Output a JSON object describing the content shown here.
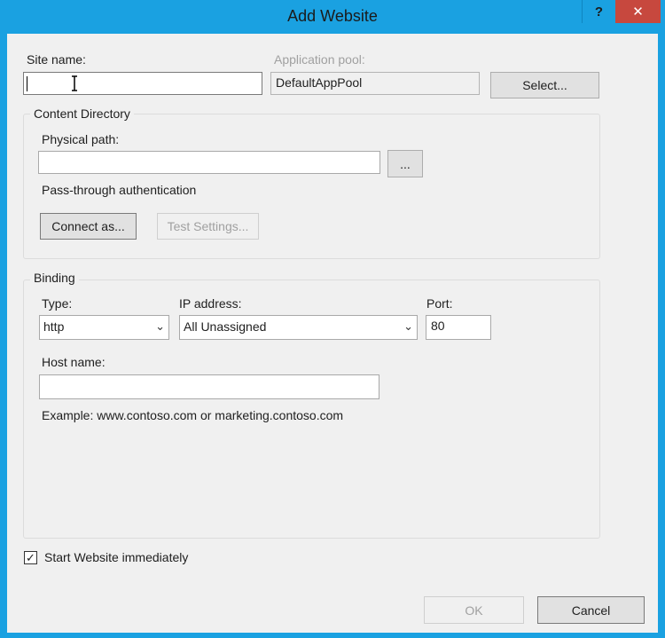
{
  "window": {
    "title": "Add Website",
    "help_label": "?",
    "close_label": "✕"
  },
  "site": {
    "site_name_label": "Site name:",
    "site_name_value": "",
    "app_pool_label": "Application pool:",
    "app_pool_value": "DefaultAppPool",
    "select_button": "Select..."
  },
  "content_directory": {
    "group_label": "Content Directory",
    "physical_path_label": "Physical path:",
    "physical_path_value": "",
    "browse_button": "...",
    "pass_through_label": "Pass-through authentication",
    "connect_as_button": "Connect as...",
    "test_settings_button": "Test Settings..."
  },
  "binding": {
    "group_label": "Binding",
    "type_label": "Type:",
    "type_value": "http",
    "ip_label": "IP address:",
    "ip_value": "All Unassigned",
    "port_label": "Port:",
    "port_value": "80",
    "host_label": "Host name:",
    "host_value": "",
    "example_text": "Example: www.contoso.com or marketing.contoso.com"
  },
  "start": {
    "label": "Start Website immediately",
    "checked": true,
    "check_glyph": "✓"
  },
  "footer": {
    "ok_button": "OK",
    "cancel_button": "Cancel"
  },
  "colors": {
    "titlebar": "#1aa1e1",
    "close": "#c7483e",
    "dialog_bg": "#f0f0f0"
  }
}
